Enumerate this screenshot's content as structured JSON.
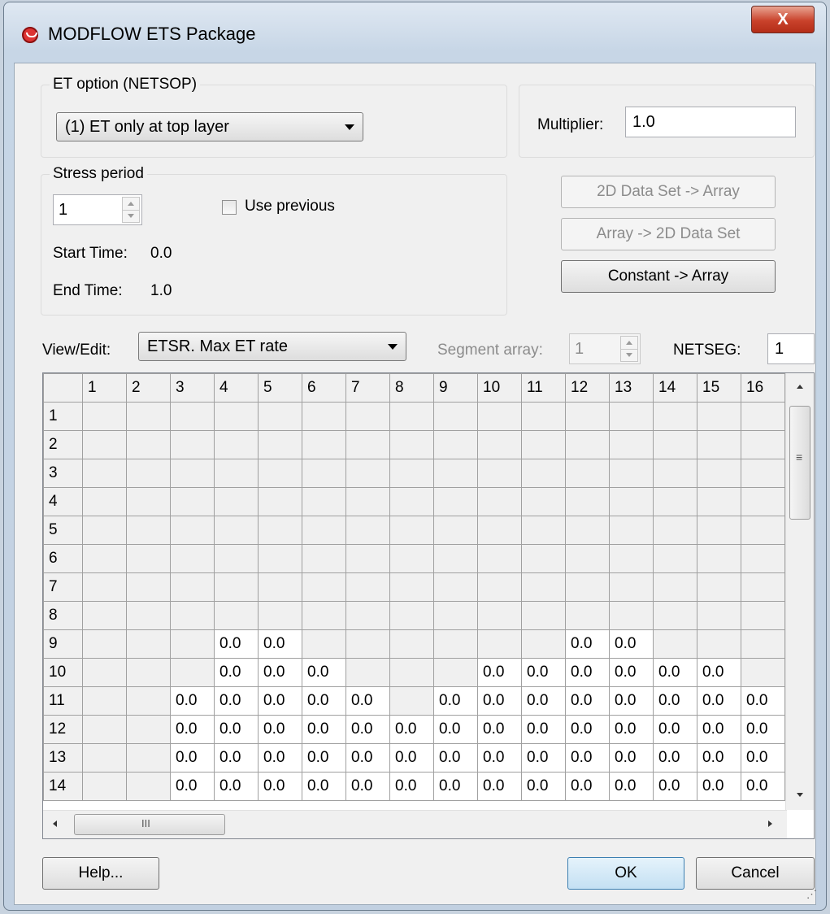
{
  "window": {
    "title": "MODFLOW ETS Package",
    "close_label": "X"
  },
  "et_option": {
    "group_label": "ET option (NETSOP)",
    "selected": "(1) ET only at top layer"
  },
  "multiplier": {
    "label": "Multiplier:",
    "value": "1.0"
  },
  "stress_period": {
    "group_label": "Stress period",
    "value": "1",
    "use_previous_label": "Use previous",
    "use_previous_checked": false,
    "start_time_label": "Start Time:",
    "start_time_value": "0.0",
    "end_time_label": "End Time:",
    "end_time_value": "1.0"
  },
  "buttons": {
    "dataset_to_array": "2D Data Set -> Array",
    "array_to_dataset": "Array -> 2D Data Set",
    "constant_to_array": "Constant -> Array",
    "help": "Help...",
    "ok": "OK",
    "cancel": "Cancel"
  },
  "view_edit": {
    "label": "View/Edit:",
    "selected": "ETSR. Max ET rate"
  },
  "segment_array": {
    "label": "Segment array:",
    "value": "1"
  },
  "netseg": {
    "label": "NETSEG:",
    "value": "1"
  },
  "grid": {
    "columns": [
      "1",
      "2",
      "3",
      "4",
      "5",
      "6",
      "7",
      "8",
      "9",
      "10",
      "11",
      "12",
      "13",
      "14",
      "15",
      "16"
    ],
    "rows": [
      {
        "label": "1",
        "cells": [
          "",
          "",
          "",
          "",
          "",
          "",
          "",
          "",
          "",
          "",
          "",
          "",
          "",
          "",
          "",
          ""
        ]
      },
      {
        "label": "2",
        "cells": [
          "",
          "",
          "",
          "",
          "",
          "",
          "",
          "",
          "",
          "",
          "",
          "",
          "",
          "",
          "",
          ""
        ]
      },
      {
        "label": "3",
        "cells": [
          "",
          "",
          "",
          "",
          "",
          "",
          "",
          "",
          "",
          "",
          "",
          "",
          "",
          "",
          "",
          ""
        ]
      },
      {
        "label": "4",
        "cells": [
          "",
          "",
          "",
          "",
          "",
          "",
          "",
          "",
          "",
          "",
          "",
          "",
          "",
          "",
          "",
          ""
        ]
      },
      {
        "label": "5",
        "cells": [
          "",
          "",
          "",
          "",
          "",
          "",
          "",
          "",
          "",
          "",
          "",
          "",
          "",
          "",
          "",
          ""
        ]
      },
      {
        "label": "6",
        "cells": [
          "",
          "",
          "",
          "",
          "",
          "",
          "",
          "",
          "",
          "",
          "",
          "",
          "",
          "",
          "",
          ""
        ]
      },
      {
        "label": "7",
        "cells": [
          "",
          "",
          "",
          "",
          "",
          "",
          "",
          "",
          "",
          "",
          "",
          "",
          "",
          "",
          "",
          ""
        ]
      },
      {
        "label": "8",
        "cells": [
          "",
          "",
          "",
          "",
          "",
          "",
          "",
          "",
          "",
          "",
          "",
          "",
          "",
          "",
          "",
          ""
        ]
      },
      {
        "label": "9",
        "cells": [
          "",
          "",
          "",
          "0.0",
          "0.0",
          "",
          "",
          "",
          "",
          "",
          "",
          "0.0",
          "0.0",
          "",
          "",
          ""
        ]
      },
      {
        "label": "10",
        "cells": [
          "",
          "",
          "",
          "0.0",
          "0.0",
          "0.0",
          "",
          "",
          "",
          "0.0",
          "0.0",
          "0.0",
          "0.0",
          "0.0",
          "0.0",
          ""
        ]
      },
      {
        "label": "11",
        "cells": [
          "",
          "",
          "0.0",
          "0.0",
          "0.0",
          "0.0",
          "0.0",
          "",
          "0.0",
          "0.0",
          "0.0",
          "0.0",
          "0.0",
          "0.0",
          "0.0",
          "0.0"
        ]
      },
      {
        "label": "12",
        "cells": [
          "",
          "",
          "0.0",
          "0.0",
          "0.0",
          "0.0",
          "0.0",
          "0.0",
          "0.0",
          "0.0",
          "0.0",
          "0.0",
          "0.0",
          "0.0",
          "0.0",
          "0.0"
        ]
      },
      {
        "label": "13",
        "cells": [
          "",
          "",
          "0.0",
          "0.0",
          "0.0",
          "0.0",
          "0.0",
          "0.0",
          "0.0",
          "0.0",
          "0.0",
          "0.0",
          "0.0",
          "0.0",
          "0.0",
          "0.0"
        ]
      },
      {
        "label": "14",
        "cells": [
          "",
          "",
          "0.0",
          "0.0",
          "0.0",
          "0.0",
          "0.0",
          "0.0",
          "0.0",
          "0.0",
          "0.0",
          "0.0",
          "0.0",
          "0.0",
          "0.0",
          "0.0"
        ]
      }
    ],
    "hscroll_grip": "III",
    "vscroll_grip": "≡"
  }
}
